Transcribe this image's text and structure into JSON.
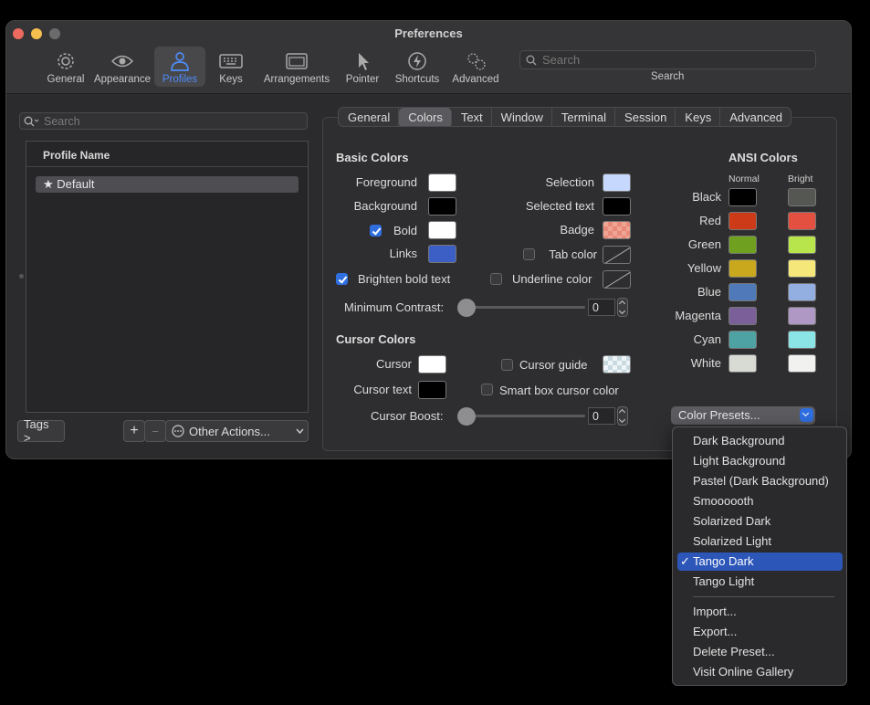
{
  "window": {
    "title": "Preferences"
  },
  "toolbar": {
    "items": [
      {
        "label": "General",
        "icon": "gear-icon"
      },
      {
        "label": "Appearance",
        "icon": "eye-icon"
      },
      {
        "label": "Profiles",
        "icon": "person-icon"
      },
      {
        "label": "Keys",
        "icon": "keyboard-icon"
      },
      {
        "label": "Arrangements",
        "icon": "windows-icon"
      },
      {
        "label": "Pointer",
        "icon": "pointer-icon"
      },
      {
        "label": "Shortcuts",
        "icon": "bolt-icon"
      },
      {
        "label": "Advanced",
        "icon": "gears-icon"
      }
    ],
    "active": "Profiles",
    "search_placeholder": "Search",
    "search_label": "Search"
  },
  "profiles": {
    "search_placeholder": "Search",
    "column_header": "Profile Name",
    "items": [
      {
        "label": "★ Default"
      }
    ],
    "tags_button": "Tags >",
    "add_button": "+",
    "remove_button": "−",
    "other_actions": "Other Actions..."
  },
  "tabs": [
    "General",
    "Colors",
    "Text",
    "Window",
    "Terminal",
    "Session",
    "Keys",
    "Advanced"
  ],
  "active_tab": "Colors",
  "basic_colors": {
    "title": "Basic Colors",
    "foreground": {
      "label": "Foreground",
      "color": "#ffffff"
    },
    "background": {
      "label": "Background",
      "color": "#000000"
    },
    "bold": {
      "label": "Bold",
      "color": "#ffffff",
      "checked": true
    },
    "links": {
      "label": "Links",
      "color": "#3b5fc4"
    },
    "brighten_bold": {
      "label": "Brighten bold text",
      "checked": true
    },
    "selection": {
      "label": "Selection",
      "color": "#c7d8ff"
    },
    "selected_text": {
      "label": "Selected text",
      "color": "#000000"
    },
    "badge": {
      "label": "Badge"
    },
    "tab_color": {
      "label": "Tab color",
      "checked": false
    },
    "underline_color": {
      "label": "Underline color",
      "checked": false
    },
    "min_contrast": {
      "label": "Minimum Contrast:",
      "value": "0"
    }
  },
  "cursor_colors": {
    "title": "Cursor Colors",
    "cursor": {
      "label": "Cursor",
      "color": "#ffffff"
    },
    "cursor_text": {
      "label": "Cursor text",
      "color": "#000000"
    },
    "cursor_guide": {
      "label": "Cursor guide",
      "checked": false
    },
    "smart_box": {
      "label": "Smart box cursor color",
      "checked": false
    },
    "cursor_boost": {
      "label": "Cursor Boost:",
      "value": "0"
    }
  },
  "ansi": {
    "title": "ANSI Colors",
    "normal_label": "Normal",
    "bright_label": "Bright",
    "rows": [
      {
        "name": "Black",
        "normal": "#000000",
        "bright": "#555753"
      },
      {
        "name": "Red",
        "normal": "#cc3a17",
        "bright": "#e3503f"
      },
      {
        "name": "Green",
        "normal": "#6fa020",
        "bright": "#b8e54c"
      },
      {
        "name": "Yellow",
        "normal": "#c9a81d",
        "bright": "#f6e77a"
      },
      {
        "name": "Blue",
        "normal": "#4f79b8",
        "bright": "#93aee0"
      },
      {
        "name": "Magenta",
        "normal": "#7b5f98",
        "bright": "#b098c4"
      },
      {
        "name": "Cyan",
        "normal": "#4fa2a4",
        "bright": "#8be4e5"
      },
      {
        "name": "White",
        "normal": "#d8dad4",
        "bright": "#f1f1ef"
      }
    ]
  },
  "presets": {
    "button_label": "Color Presets...",
    "menu_items": [
      {
        "label": "Dark Background"
      },
      {
        "label": "Light Background"
      },
      {
        "label": "Pastel (Dark Background)"
      },
      {
        "label": "Smoooooth"
      },
      {
        "label": "Solarized Dark"
      },
      {
        "label": "Solarized Light"
      },
      {
        "label": "Tango Dark",
        "selected": true
      },
      {
        "label": "Tango Light"
      }
    ],
    "action_items": [
      {
        "label": "Import..."
      },
      {
        "label": "Export..."
      },
      {
        "label": "Delete Preset..."
      },
      {
        "label": "Visit Online Gallery"
      }
    ],
    "checkmark": "✓"
  }
}
